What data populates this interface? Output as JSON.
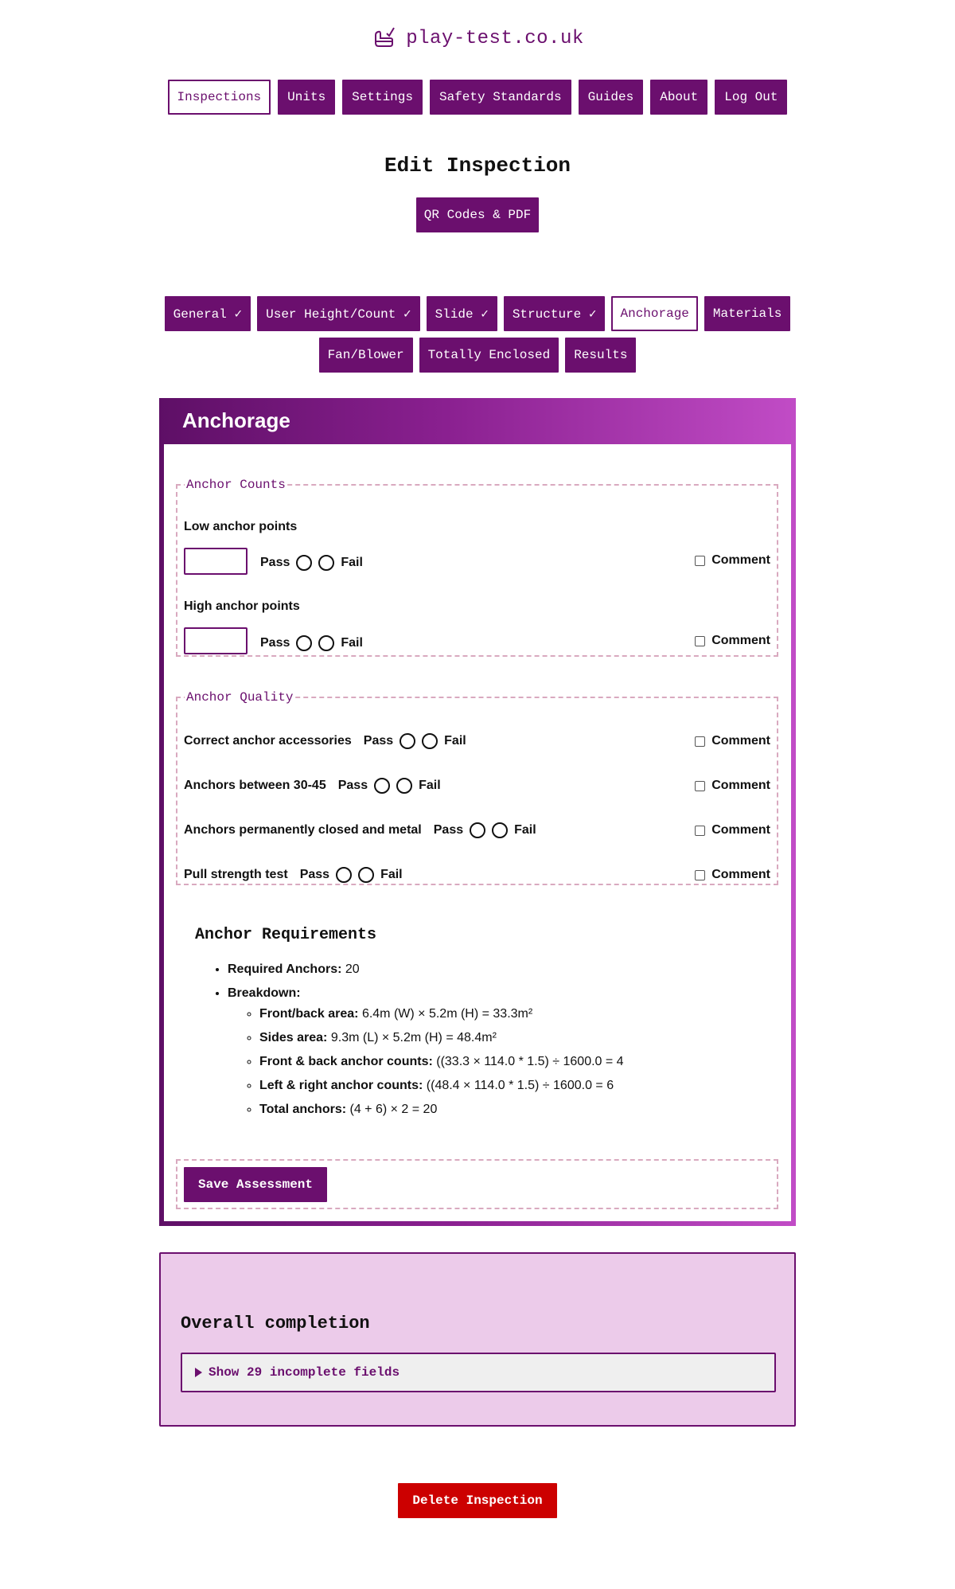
{
  "site": {
    "name": "play-test.co.uk",
    "logo_icon": "bouncy-castle-logo-icon"
  },
  "nav": {
    "items": [
      {
        "label": "Inspections",
        "active": true
      },
      {
        "label": "Units"
      },
      {
        "label": "Settings"
      },
      {
        "label": "Safety Standards"
      },
      {
        "label": "Guides"
      },
      {
        "label": "About"
      },
      {
        "label": "Log Out"
      }
    ]
  },
  "page": {
    "title": "Edit Inspection",
    "qr_button": "QR Codes & PDF"
  },
  "tabs": [
    {
      "label": "General ✓"
    },
    {
      "label": "User Height/Count ✓"
    },
    {
      "label": "Slide ✓"
    },
    {
      "label": "Structure ✓"
    },
    {
      "label": "Anchorage",
      "active": true
    },
    {
      "label": "Materials"
    },
    {
      "label": "Fan/Blower"
    },
    {
      "label": "Totally Enclosed"
    },
    {
      "label": "Results"
    }
  ],
  "panel": {
    "title": "Anchorage",
    "counts": {
      "legend": "Anchor Counts",
      "low_label": "Low anchor points",
      "low_value": "",
      "high_label": "High anchor points",
      "high_value": ""
    },
    "pass_label": "Pass",
    "fail_label": "Fail",
    "comment_label": "Comment",
    "quality": {
      "legend": "Anchor Quality",
      "rows": [
        {
          "label": "Correct anchor accessories"
        },
        {
          "label": "Anchors between 30-45"
        },
        {
          "label": "Anchors permanently closed and metal"
        },
        {
          "label": "Pull strength test"
        }
      ]
    },
    "requirements": {
      "title": "Anchor Requirements",
      "required_label": "Required Anchors:",
      "required_value": "20",
      "breakdown_label": "Breakdown:",
      "breakdown": [
        {
          "label": "Front/back area:",
          "value": "6.4m (W) × 5.2m (H) = 33.3m²"
        },
        {
          "label": "Sides area:",
          "value": "9.3m (L) × 5.2m (H) = 48.4m²"
        },
        {
          "label": "Front & back anchor counts:",
          "value": "((33.3 × 114.0 * 1.5) ÷ 1600.0 = 4"
        },
        {
          "label": "Left & right anchor counts:",
          "value": "((48.4 × 114.0 * 1.5) ÷ 1600.0 = 6"
        },
        {
          "label": "Total anchors:",
          "value": "(4 + 6) × 2 = 20"
        }
      ]
    },
    "save_button": "Save Assessment"
  },
  "completion": {
    "title": "Overall completion",
    "summary": "Show 29 incomplete fields"
  },
  "delete_button": "Delete Inspection",
  "colors": {
    "brand": "#6b0f6e",
    "danger": "#cc0000",
    "completion_bg": "#eccbea"
  }
}
